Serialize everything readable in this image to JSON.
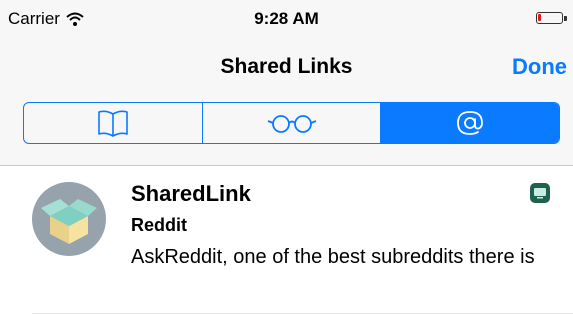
{
  "status_bar": {
    "carrier": "Carrier",
    "time": "9:28 AM"
  },
  "nav": {
    "title": "Shared Links",
    "done_label": "Done"
  },
  "segments": [
    {
      "icon": "book-icon",
      "selected": false
    },
    {
      "icon": "glasses-icon",
      "selected": false
    },
    {
      "icon": "at-sign-icon",
      "selected": true
    }
  ],
  "shared_link": {
    "title": "SharedLink",
    "subtitle": "Reddit",
    "body": "AskReddit, one of the best subreddits there is",
    "app_badge_icon": "computer-icon"
  },
  "colors": {
    "accent": "#0a7aff",
    "battery_low": "#e0191e",
    "avatar_bg": "#96a3ad",
    "box_top": "#7fd0c2",
    "box_side": "#f6e3a1"
  }
}
